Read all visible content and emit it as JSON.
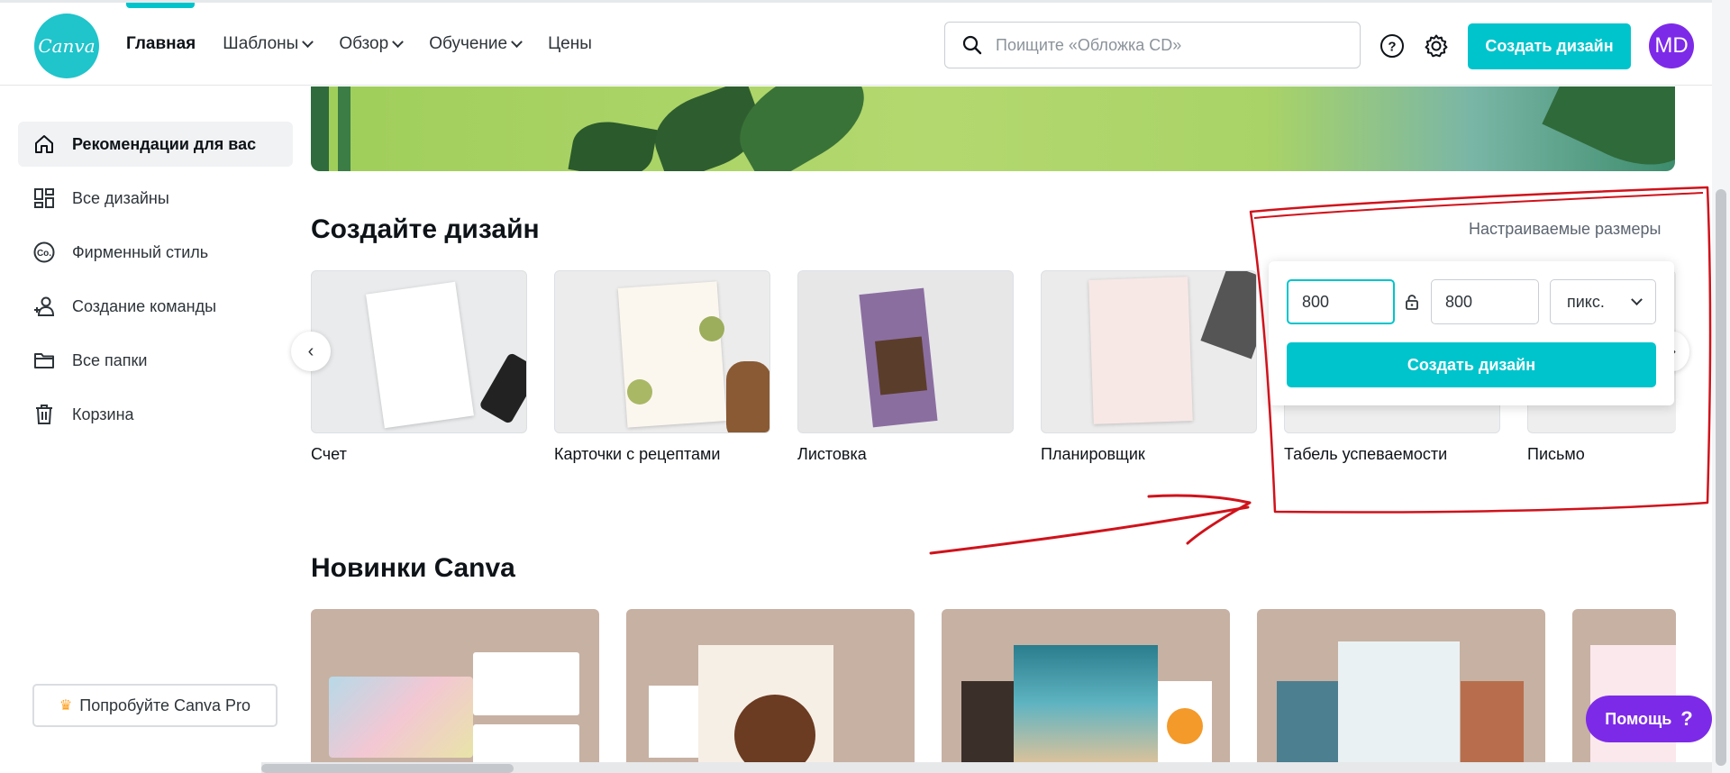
{
  "header": {
    "logo_text": "Canva",
    "nav": [
      {
        "label": "Главная"
      },
      {
        "label": "Шаблоны"
      },
      {
        "label": "Обзор"
      },
      {
        "label": "Обучение"
      },
      {
        "label": "Цены"
      }
    ],
    "search_placeholder": "Поищите «Обложка CD»",
    "create_label": "Создать дизайн",
    "avatar_initials": "MD"
  },
  "sidebar": {
    "items": [
      {
        "label": "Рекомендации для вас",
        "icon": "home-icon"
      },
      {
        "label": "Все дизайны",
        "icon": "grid-icon"
      },
      {
        "label": "Фирменный стиль",
        "icon": "brand-icon"
      },
      {
        "label": "Создание команды",
        "icon": "team-icon"
      },
      {
        "label": "Все папки",
        "icon": "folder-icon"
      },
      {
        "label": "Корзина",
        "icon": "trash-icon"
      }
    ],
    "pro_label": "Попробуйте Canva Pro"
  },
  "main": {
    "create_title": "Создайте дизайн",
    "custom_size_label": "Настраиваемые размеры",
    "design_types": [
      {
        "label": "Счет"
      },
      {
        "label": "Карточки с рецептами"
      },
      {
        "label": "Листовка"
      },
      {
        "label": "Планировщик"
      },
      {
        "label": "Табель успеваемости"
      },
      {
        "label": "Письмо"
      }
    ],
    "custom_size": {
      "width": "800",
      "height": "800",
      "unit": "пикс.",
      "create_label": "Создать дизайн"
    },
    "new_title": "Новинки Canva"
  },
  "help_label": "Помощь",
  "help_icon": "?",
  "colors": {
    "accent": "#00c4cc",
    "purple": "#7d2ae8",
    "annotation": "#d0121b"
  }
}
